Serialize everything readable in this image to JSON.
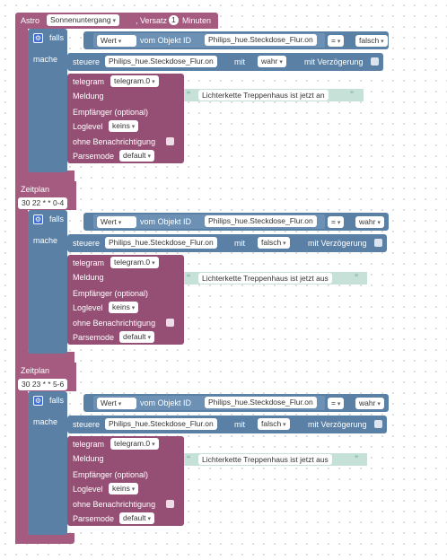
{
  "astro": {
    "label": "Astro",
    "event": "Sonnenuntergang",
    "offset_label": ", Versatz",
    "offset_value": "1",
    "unit_label": "Minuten"
  },
  "labels": {
    "if": "falls",
    "do": "mache",
    "value": "Wert",
    "from_object": "vom Objekt ID",
    "control": "steuere",
    "with": "mit",
    "with_delay": "mit Verzögerung",
    "telegram": "telegram",
    "message": "Meldung",
    "recipient": "Empfänger (optional)",
    "loglevel": "Loglevel",
    "silent": "ohne Benachrichtigung",
    "parsemode": "Parsemode",
    "schedule": "Zeitplan"
  },
  "blocks": [
    {
      "object_id": "Philips_hue.Steckdose_Flur.on",
      "operator": "=",
      "compare": "falsch",
      "control_id": "Philips_hue.Steckdose_Flur.on",
      "set_value": "wahr",
      "telegram_instance": "telegram.0",
      "message_text": "Lichterkette Treppenhaus ist jetzt an",
      "loglevel": "keins",
      "parsemode": "default"
    },
    {
      "cron": "30 22 * * 0-4",
      "object_id": "Philips_hue.Steckdose_Flur.on",
      "operator": "=",
      "compare": "wahr",
      "control_id": "Philips_hue.Steckdose_Flur.on",
      "set_value": "falsch",
      "telegram_instance": "telegram.0",
      "message_text": "Lichterkette Treppenhaus ist jetzt aus",
      "loglevel": "keins",
      "parsemode": "default"
    },
    {
      "cron": "30 23 * * 5-6",
      "object_id": "Philips_hue.Steckdose_Flur.on",
      "operator": "=",
      "compare": "wahr",
      "control_id": "Philips_hue.Steckdose_Flur.on",
      "set_value": "falsch",
      "telegram_instance": "telegram.0",
      "message_text": "Lichterkette Treppenhaus ist jetzt aus",
      "loglevel": "keins",
      "parsemode": "default"
    }
  ]
}
